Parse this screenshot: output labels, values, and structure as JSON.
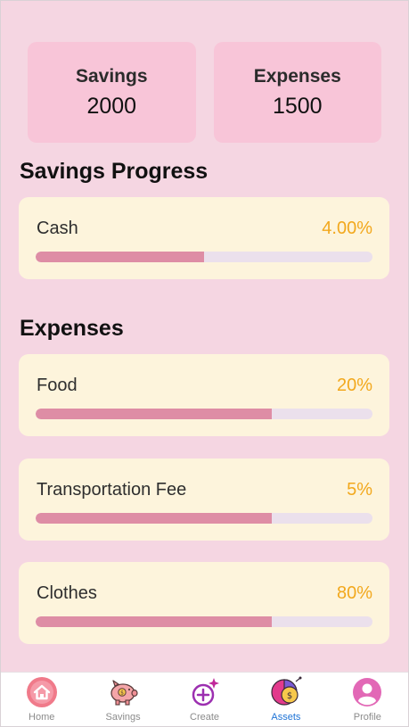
{
  "summary": {
    "savings": {
      "label": "Savings",
      "value": "2000"
    },
    "expenses": {
      "label": "Expenses",
      "value": "1500"
    }
  },
  "savings_progress": {
    "title": "Savings Progress",
    "items": [
      {
        "label": "Cash",
        "percent": "4.00%",
        "bar_fill": 0.5
      }
    ]
  },
  "expenses_section": {
    "title": "Expenses",
    "items": [
      {
        "label": "Food",
        "percent": "20%",
        "bar_fill": 0.7
      },
      {
        "label": "Transportation Fee",
        "percent": "5%",
        "bar_fill": 0.7
      },
      {
        "label": "Clothes",
        "percent": "80%",
        "bar_fill": 0.7
      }
    ]
  },
  "bottom_nav": {
    "items": [
      {
        "label": "Home",
        "icon": "home-icon"
      },
      {
        "label": "Savings",
        "icon": "piggy-bank-icon"
      },
      {
        "label": "Create",
        "icon": "add-sparkle-icon"
      },
      {
        "label": "Assets",
        "icon": "pie-chart-coin-icon",
        "active": true
      },
      {
        "label": "Profile",
        "icon": "user-icon"
      }
    ]
  },
  "colors": {
    "background": "#f5d6e2",
    "stat_card": "#f8c5d8",
    "progress_card": "#fdf4dc",
    "bar_fill": "#de8da5",
    "bar_track": "#ebe0ec",
    "percent_text": "#f2a81d",
    "nav_active": "#1e73d6"
  }
}
